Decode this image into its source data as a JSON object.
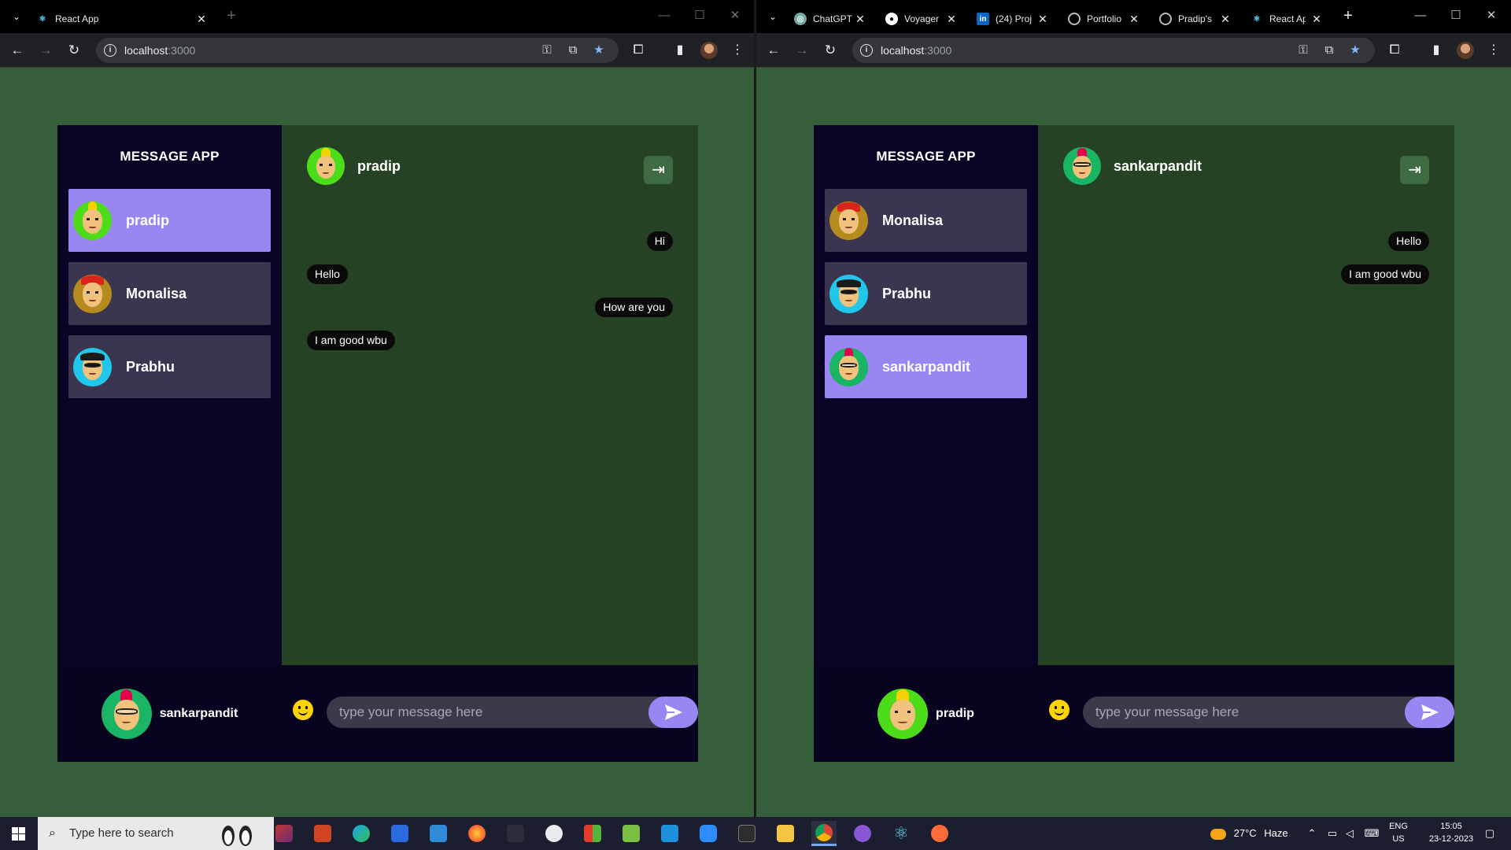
{
  "left_window": {
    "tabs": [
      {
        "title": "React App",
        "icon": "react-icon",
        "active": true
      }
    ],
    "url": "localhost",
    "port": ":3000",
    "app": {
      "brand": "MESSAGE APP",
      "contacts": [
        {
          "name": "pradip",
          "avatar": "green",
          "selected": true
        },
        {
          "name": "Monalisa",
          "avatar": "gold",
          "selected": false
        },
        {
          "name": "Prabhu",
          "avatar": "cyan",
          "selected": false
        }
      ],
      "current_user": "sankarpandit",
      "chat_user": "pradip",
      "messages": [
        {
          "text": "Hi",
          "direction": "out"
        },
        {
          "text": "Hello",
          "direction": "in"
        },
        {
          "text": "How are you",
          "direction": "out"
        },
        {
          "text": "I am good wbu",
          "direction": "in"
        }
      ],
      "input_placeholder": "type your message here"
    }
  },
  "right_window": {
    "tabs": [
      {
        "title": "ChatGPT",
        "icon": "chatgpt-icon"
      },
      {
        "title": "Voyager",
        "icon": "github-icon"
      },
      {
        "title": "(24) Proj",
        "icon": "linkedin-icon"
      },
      {
        "title": "Portfolio",
        "icon": "globe-icon"
      },
      {
        "title": "Pradip's",
        "icon": "globe-icon"
      },
      {
        "title": "React Ap",
        "icon": "react-icon",
        "active": true
      }
    ],
    "url": "localhost",
    "port": ":3000",
    "app": {
      "brand": "MESSAGE APP",
      "contacts": [
        {
          "name": "Monalisa",
          "avatar": "gold",
          "selected": false
        },
        {
          "name": "Prabhu",
          "avatar": "cyan",
          "selected": false
        },
        {
          "name": "sankarpandit",
          "avatar": "teal",
          "selected": true
        }
      ],
      "current_user": "pradip",
      "chat_user": "sankarpandit",
      "messages": [
        {
          "text": "Hello",
          "direction": "out"
        },
        {
          "text": "I am good wbu",
          "direction": "out"
        }
      ],
      "input_placeholder": "type your message here"
    }
  },
  "taskbar": {
    "search_placeholder": "Type here to search",
    "weather_temp": "27°C",
    "weather_desc": "Haze",
    "lang_line1": "ENG",
    "lang_line2": "US",
    "time": "15:05",
    "date": "23-12-2023"
  },
  "colors": {
    "page_bg": "#355f3b",
    "sidebar_bg": "#0b0326",
    "contact_bg": "#3b3550",
    "selected_bg": "#9a86f3",
    "chat_bg": "#254225",
    "accent": "#9a86f3"
  }
}
